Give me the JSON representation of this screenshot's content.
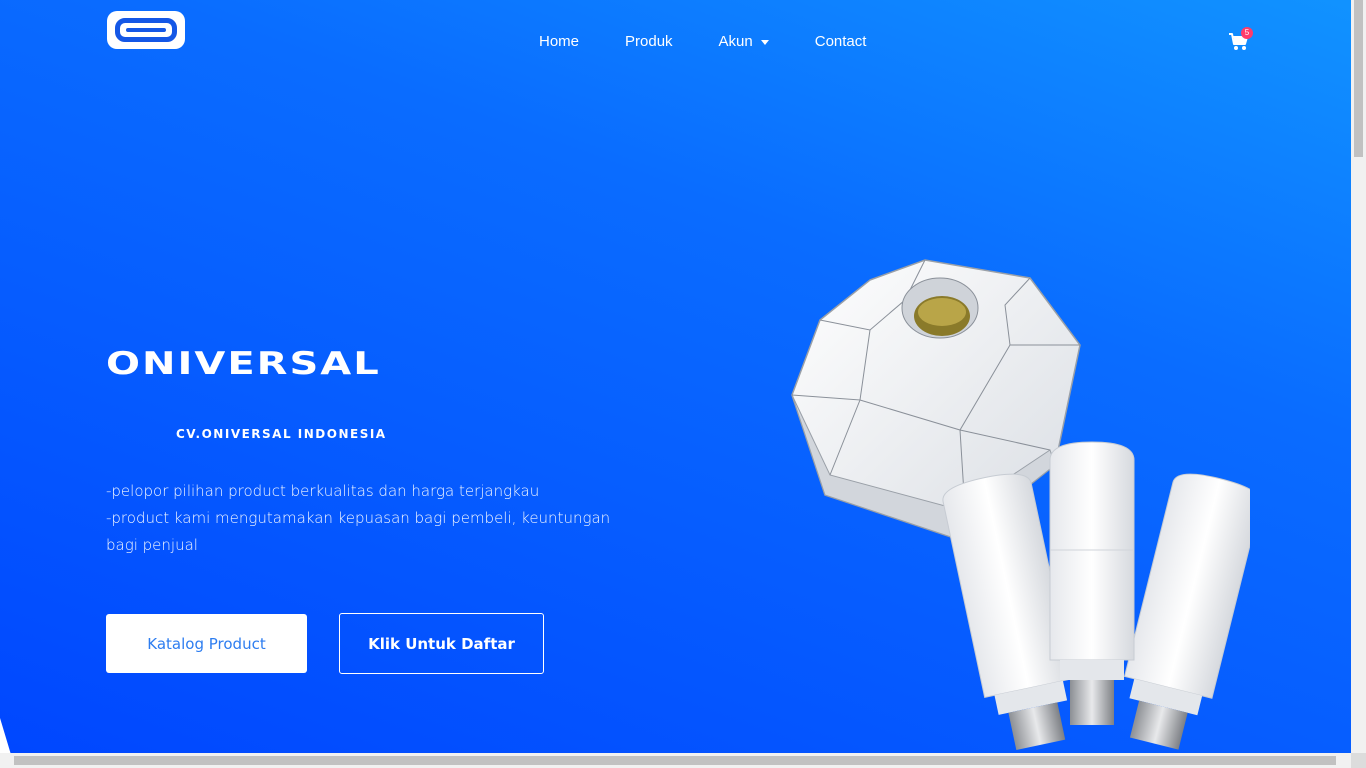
{
  "navbar": {
    "logo_icon": "oniversal-logo-icon",
    "links": [
      {
        "label": "Home"
      },
      {
        "label": "Produk"
      },
      {
        "label": "Akun"
      },
      {
        "label": "Contact"
      }
    ],
    "cart_icon": "cart-icon",
    "cart_count": "5"
  },
  "hero": {
    "brand": "ONIVERSAL",
    "subtitle": "CV.ONIVERSAL INDONESIA",
    "line1": "-pelopor pilihan product berkualitas dan harga terjangkau",
    "line2": "-product kami mengutamakan kepuasan bagi pembeli, keuntungan bagi penjual",
    "primary_button": "Katalog Product",
    "secondary_button": "Klik Untuk Daftar",
    "image_icon": "led-bulb-product-image"
  },
  "colors": {
    "bg_start": "#1193ff",
    "bg_end": "#0046ff",
    "accent": "#2d7df0",
    "badge": "#ff3b6b"
  }
}
